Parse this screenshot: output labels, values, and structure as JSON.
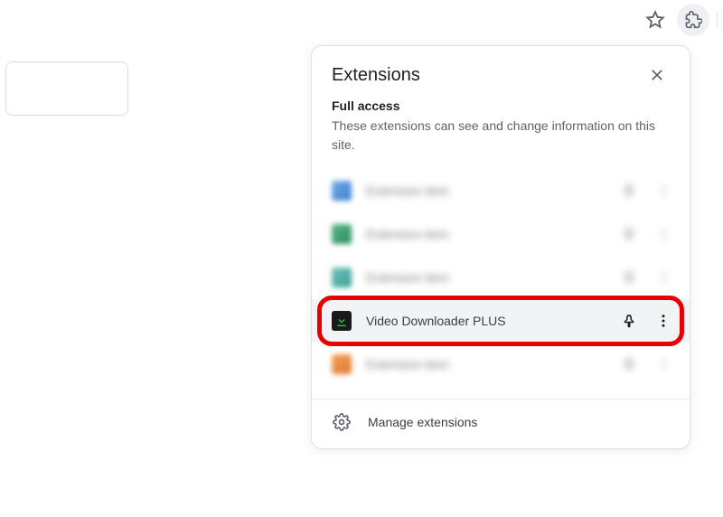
{
  "popup": {
    "title": "Extensions",
    "access_label": "Full access",
    "access_desc": "These extensions can see and change information on this site.",
    "manage_label": "Manage extensions"
  },
  "extensions": [
    {
      "name": "Extension item",
      "icon": "blue",
      "blurred": true,
      "highlighted": false
    },
    {
      "name": "Extension item",
      "icon": "green",
      "blurred": true,
      "highlighted": false
    },
    {
      "name": "Extension item",
      "icon": "teal",
      "blurred": true,
      "highlighted": false
    },
    {
      "name": "Video Downloader PLUS",
      "icon": "dark-arrow",
      "blurred": false,
      "highlighted": true
    },
    {
      "name": "Extension item",
      "icon": "orange",
      "blurred": true,
      "highlighted": false
    }
  ]
}
